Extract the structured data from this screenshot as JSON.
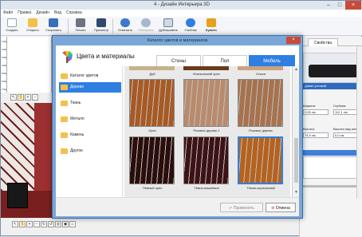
{
  "window": {
    "title": "4 - Дизайн Интерьера 3D"
  },
  "menu": [
    "Файл",
    "Правка",
    "Дизайн",
    "Вид",
    "Справка"
  ],
  "toolbar": {
    "create": "Создать",
    "open": "Открыть",
    "save": "Сохранить",
    "print": "Печать",
    "preview": "Просмотр",
    "undo": "Отменить",
    "redo": "Повторить",
    "duplicate": "Дублировать",
    "tutorial": "Учебник",
    "buy": "Купить"
  },
  "ruler_marks": [
    "1.5м",
    "2.5м",
    "3.5м",
    "4.5м",
    "5.5м",
    "6.5м",
    "7.5м"
  ],
  "right_panel": {
    "tab_properties": "Свойства",
    "selected_name": "Диван угловой",
    "width_label": "Ширина:",
    "width_value": "2,00 см",
    "depth_label": "Глубина:",
    "depth_value": "112,1 см",
    "height_label": "Высота:",
    "height_value": "74,9 см",
    "elevation_label": "Высота над полом:",
    "elevation_value": "0,0 см"
  },
  "dialog": {
    "title": "Каталог цветов и материалов",
    "heading": "Цвета и материалы",
    "tabs": [
      "Стены",
      "Пол",
      "Мебель"
    ],
    "categories": [
      "Каталог цветов",
      "Дерево",
      "Ткань",
      "Металл",
      "Камень",
      "Другое"
    ],
    "top_labels": [
      "Дуб",
      "Итальянский орех",
      "Ольха"
    ],
    "swatches": [
      {
        "name": "Орех",
        "color": "#a85a24"
      },
      {
        "name": "Розовое дерево 2",
        "color": "#b98b6c"
      },
      {
        "name": "Розовое дерево",
        "color": "#a7724e"
      },
      {
        "name": "Тёмный орех",
        "color": "#2a0e0c"
      },
      {
        "name": "Тёмно-вишнёвое",
        "color": "#3d1216"
      },
      {
        "name": "Тёмно-коричневый",
        "color": "#b5621e"
      }
    ],
    "apply": "Применить",
    "cancel": "Отмена"
  },
  "colors": {
    "accent": "#2f7fe3",
    "folder": "#f3c14b"
  }
}
